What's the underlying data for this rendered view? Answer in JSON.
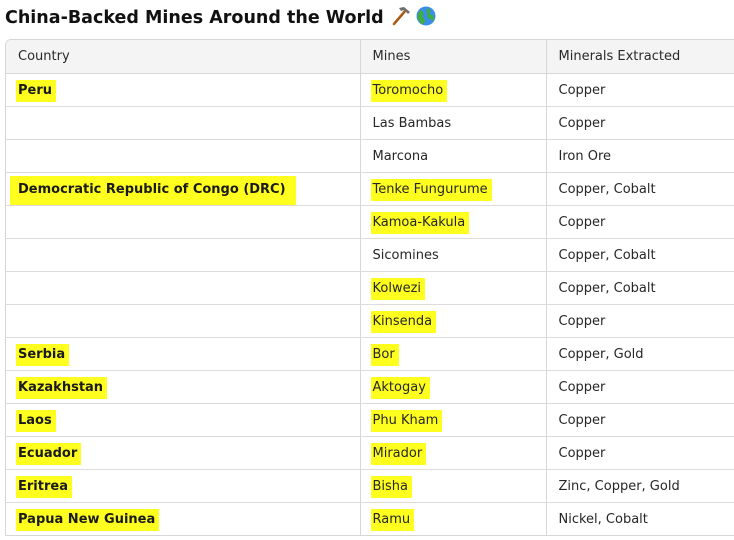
{
  "title": "China-Backed Mines Around the World",
  "icons": [
    "hammer-pick-icon",
    "globe-icon"
  ],
  "colors": {
    "highlight": "#ffff1f",
    "header_bg": "#f4f4f4",
    "border": "#d6d6d6"
  },
  "table": {
    "headers": [
      "Country",
      "Mines",
      "Minerals Extracted"
    ],
    "rows": [
      {
        "country": "Peru",
        "mine": "Toromocho",
        "minerals": "Copper",
        "country_hl": true,
        "mine_hl": true
      },
      {
        "country": "",
        "mine": "Las Bambas",
        "minerals": "Copper",
        "country_hl": false,
        "mine_hl": false
      },
      {
        "country": "",
        "mine": "Marcona",
        "minerals": "Iron Ore",
        "country_hl": false,
        "mine_hl": false
      },
      {
        "country": "Democratic Republic of Congo (DRC)",
        "mine": "Tenke Fungurume",
        "minerals": "Copper, Cobalt",
        "country_hl": true,
        "mine_hl": true
      },
      {
        "country": "",
        "mine": "Kamoa-Kakula",
        "minerals": "Copper",
        "country_hl": false,
        "mine_hl": true
      },
      {
        "country": "",
        "mine": "Sicomines",
        "minerals": "Copper, Cobalt",
        "country_hl": false,
        "mine_hl": false
      },
      {
        "country": "",
        "mine": "Kolwezi",
        "minerals": "Copper, Cobalt",
        "country_hl": false,
        "mine_hl": true
      },
      {
        "country": "",
        "mine": "Kinsenda",
        "minerals": "Copper",
        "country_hl": false,
        "mine_hl": true
      },
      {
        "country": "Serbia",
        "mine": "Bor",
        "minerals": "Copper, Gold",
        "country_hl": true,
        "mine_hl": true
      },
      {
        "country": "Kazakhstan",
        "mine": "Aktogay",
        "minerals": "Copper",
        "country_hl": true,
        "mine_hl": true
      },
      {
        "country": "Laos",
        "mine": "Phu Kham",
        "minerals": "Copper",
        "country_hl": true,
        "mine_hl": true
      },
      {
        "country": "Ecuador",
        "mine": "Mirador",
        "minerals": "Copper",
        "country_hl": true,
        "mine_hl": true
      },
      {
        "country": "Eritrea",
        "mine": "Bisha",
        "minerals": "Zinc, Copper, Gold",
        "country_hl": true,
        "mine_hl": true
      },
      {
        "country": "Papua New Guinea",
        "mine": "Ramu",
        "minerals": "Nickel, Cobalt",
        "country_hl": true,
        "mine_hl": true
      }
    ]
  }
}
